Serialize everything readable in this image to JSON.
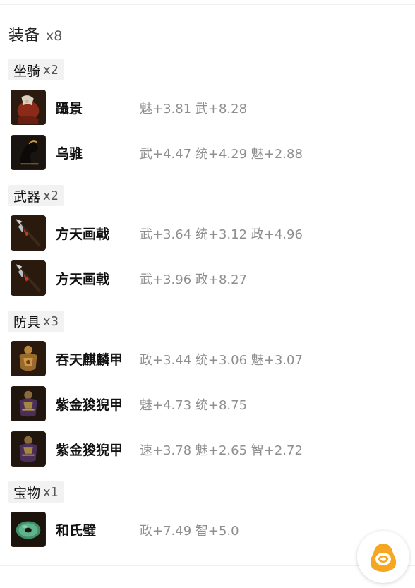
{
  "section": {
    "title": "装备",
    "count": "x8"
  },
  "categories": [
    {
      "label": "坐骑",
      "count": "x2",
      "items": [
        {
          "name": "躡景",
          "stats": "魅+3.81 武+8.28",
          "icon": "horse-red-icon"
        },
        {
          "name": "乌骓",
          "stats": "武+4.47 统+4.29 魅+2.88",
          "icon": "horse-black-icon"
        }
      ]
    },
    {
      "label": "武器",
      "count": "x2",
      "items": [
        {
          "name": "方天画戟",
          "stats": "武+3.64 统+3.12 政+4.96",
          "icon": "halberd-icon"
        },
        {
          "name": "方天画戟",
          "stats": "武+3.96 政+8.27",
          "icon": "halberd-icon"
        }
      ]
    },
    {
      "label": "防具",
      "count": "x3",
      "items": [
        {
          "name": "吞天麒麟甲",
          "stats": "政+3.44 统+3.06 魅+3.07",
          "icon": "armor-gold-icon"
        },
        {
          "name": "紫金狻猊甲",
          "stats": "魅+4.73 统+8.75",
          "icon": "armor-purple-icon"
        },
        {
          "name": "紫金狻猊甲",
          "stats": "速+3.78 魅+2.65 智+2.72",
          "icon": "armor-purple-icon"
        }
      ]
    },
    {
      "label": "宝物",
      "count": "x1",
      "items": [
        {
          "name": "和氏璧",
          "stats": "政+7.49 智+5.0",
          "icon": "jade-disc-icon"
        }
      ]
    }
  ],
  "colors": {
    "fab_accent": "#f5a623",
    "stat_text": "#8f8f8f",
    "category_bg": "#f2f2f2"
  },
  "fab": {
    "icon": "assistant-penguin-icon"
  }
}
